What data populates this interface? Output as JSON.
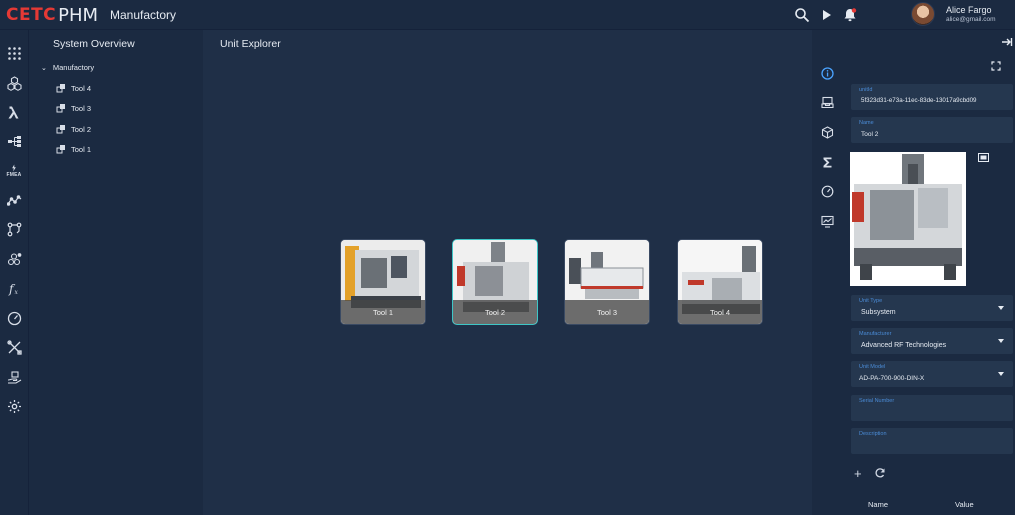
{
  "header": {
    "logo_brand": "CETC",
    "logo_product": "PHM",
    "title": "Manufactory",
    "icons": [
      "search-icon",
      "play-icon",
      "bell-icon"
    ],
    "user": {
      "name": "Alice Fargo",
      "email": "alice@gmail.com"
    }
  },
  "rail": {
    "items": [
      "apps-grid-icon",
      "cubes-icon",
      "lambda-icon",
      "tree-structure-icon",
      "fmea-icon",
      "trend-line-icon",
      "workflow-icon",
      "molecule-icon",
      "function-icon",
      "gauge-icon",
      "tools-icon",
      "hand-box-icon",
      "settings-icon"
    ],
    "fmea_label": "FMEA"
  },
  "overview": {
    "title": "System Overview",
    "root": "Manufactory",
    "items": [
      "Tool 4",
      "Tool 3",
      "Tool 2",
      "Tool 1"
    ]
  },
  "explorer": {
    "title": "Unit Explorer",
    "tools": [
      {
        "label": "Tool 1",
        "selected": false
      },
      {
        "label": "Tool 2",
        "selected": true
      },
      {
        "label": "Tool 3",
        "selected": false
      },
      {
        "label": "Tool 4",
        "selected": false
      }
    ]
  },
  "strip": {
    "items": [
      "info-icon",
      "inbox-icon",
      "cube-icon",
      "sigma-icon",
      "gauge-icon",
      "monitor-chart-icon"
    ],
    "active": "info-icon"
  },
  "properties": {
    "unitid_label": "unitId",
    "unitid_value": "5f323d31-e73a-11ec-83de-13017a9cbd09",
    "name_label": "Name",
    "name_value": "Tool 2",
    "unit_type_label": "Unit Type",
    "unit_type_value": "Subsystem",
    "manufacturer_label": "Manufacturer",
    "manufacturer_value": "Advanced RF Technologies",
    "unit_model_label": "Unit Model",
    "unit_model_value": "AD-PA-700-900-DIN-X",
    "serial_label": "Serial Number",
    "serial_value": "",
    "description_label": "Description",
    "description_value": "",
    "table_headers": {
      "name": "Name",
      "value": "Value"
    }
  }
}
